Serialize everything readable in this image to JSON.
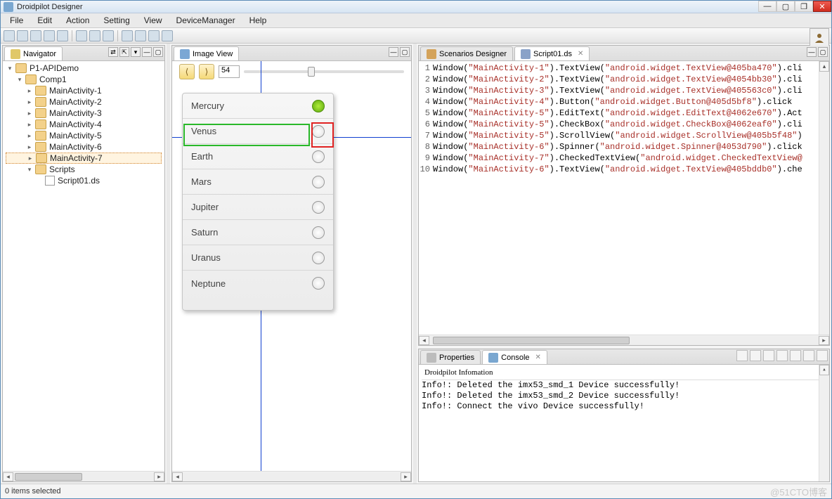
{
  "window": {
    "title": "Droidpilot Designer"
  },
  "menu": {
    "file": "File",
    "edit": "Edit",
    "action": "Action",
    "setting": "Setting",
    "view": "View",
    "deviceManager": "DeviceManager",
    "help": "Help"
  },
  "icons": {
    "perspective": "person-icon"
  },
  "navigator": {
    "title": "Navigator",
    "tree": {
      "root": "P1-APIDemo",
      "comp": "Comp1",
      "activities": [
        "MainActivity-1",
        "MainActivity-2",
        "MainActivity-3",
        "MainActivity-4",
        "MainActivity-5",
        "MainActivity-6",
        "MainActivity-7"
      ],
      "selectedIndex": 6,
      "scriptsFolder": "Scripts",
      "scriptFile": "Script01.ds"
    }
  },
  "imageView": {
    "title": "Image View",
    "frameNumber": "54",
    "planets": [
      "Mercury",
      "Venus",
      "Earth",
      "Mars",
      "Jupiter",
      "Saturn",
      "Uranus",
      "Neptune"
    ],
    "selectedPlanetIndex": 0,
    "highlightRowIndex": 1
  },
  "editorTabs": {
    "scenarios": "Scenarios Designer",
    "script": "Script01.ds"
  },
  "code": [
    {
      "n": 1,
      "pre": "Window(",
      "s1": "\"MainActivity-1\"",
      "mid": ").TextView(",
      "s2": "\"android.widget.TextView@405ba470\"",
      "post": ").cli"
    },
    {
      "n": 2,
      "pre": "Window(",
      "s1": "\"MainActivity-2\"",
      "mid": ").TextView(",
      "s2": "\"android.widget.TextView@4054bb30\"",
      "post": ").cli"
    },
    {
      "n": 3,
      "pre": "Window(",
      "s1": "\"MainActivity-3\"",
      "mid": ").TextView(",
      "s2": "\"android.widget.TextView@405563c0\"",
      "post": ").cli"
    },
    {
      "n": 4,
      "pre": "Window(",
      "s1": "\"MainActivity-4\"",
      "mid": ").Button(",
      "s2": "\"android.widget.Button@405d5bf8\"",
      "post": ").click"
    },
    {
      "n": 5,
      "pre": "Window(",
      "s1": "\"MainActivity-5\"",
      "mid": ").EditText(",
      "s2": "\"android.widget.EditText@4062e670\"",
      "post": ").Act"
    },
    {
      "n": 6,
      "pre": "Window(",
      "s1": "\"MainActivity-5\"",
      "mid": ").CheckBox(",
      "s2": "\"android.widget.CheckBox@4062eaf0\"",
      "post": ").cli"
    },
    {
      "n": 7,
      "pre": "Window(",
      "s1": "\"MainActivity-5\"",
      "mid": ").ScrollView(",
      "s2": "\"android.widget.ScrollView@405b5f48\"",
      "post": ")"
    },
    {
      "n": 8,
      "pre": "Window(",
      "s1": "\"MainActivity-6\"",
      "mid": ").Spinner(",
      "s2": "\"android.widget.Spinner@4053d790\"",
      "post": ").click"
    },
    {
      "n": 9,
      "pre": "Window(",
      "s1": "\"MainActivity-7\"",
      "mid": ").CheckedTextView(",
      "s2": "\"android.widget.CheckedTextView@",
      "post": ""
    },
    {
      "n": 10,
      "pre": "Window(",
      "s1": "\"MainActivity-6\"",
      "mid": ").TextView(",
      "s2": "\"android.widget.TextView@405bddb0\"",
      "post": ").che"
    }
  ],
  "lowerTabs": {
    "properties": "Properties",
    "console": "Console"
  },
  "console": {
    "header": "Droidpilot Infomation",
    "lines": [
      "Info!: Deleted the imx53_smd_1 Device successfully!",
      "Info!: Deleted the imx53_smd_2 Device successfully!",
      "Info!: Connect the vivo Device successfully!"
    ]
  },
  "status": {
    "text": "0 items selected",
    "watermark": "@51CTO博客"
  }
}
